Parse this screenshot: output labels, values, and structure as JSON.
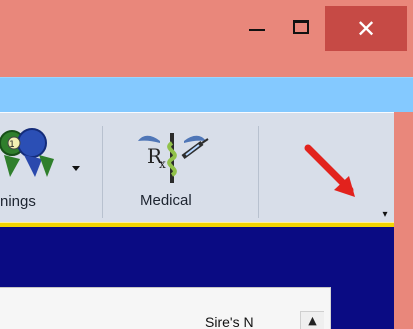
{
  "window": {
    "close_glyph": "✕",
    "min_icon": "minimize-icon",
    "max_icon": "maximize-icon",
    "close_icon": "close-icon"
  },
  "ribbon": {
    "winnings_label": "nings",
    "medical_label": "Medical",
    "expander_glyph": "▾",
    "winnings_icon": "ribbon-rosette-icon",
    "medical_icon": "rx-caduceus-icon",
    "arrow_icon": "red-arrow-icon"
  },
  "table": {
    "header_text": "Sire's N",
    "sort_glyph": "▲"
  },
  "colors": {
    "title_bar": "#e9877b",
    "close_button": "#c64a45",
    "band": "#84c9ff",
    "ribbon": "#d8dee9",
    "accent_line": "#f2d400",
    "panel": "#0a0b83",
    "arrow": "#e2221d"
  }
}
